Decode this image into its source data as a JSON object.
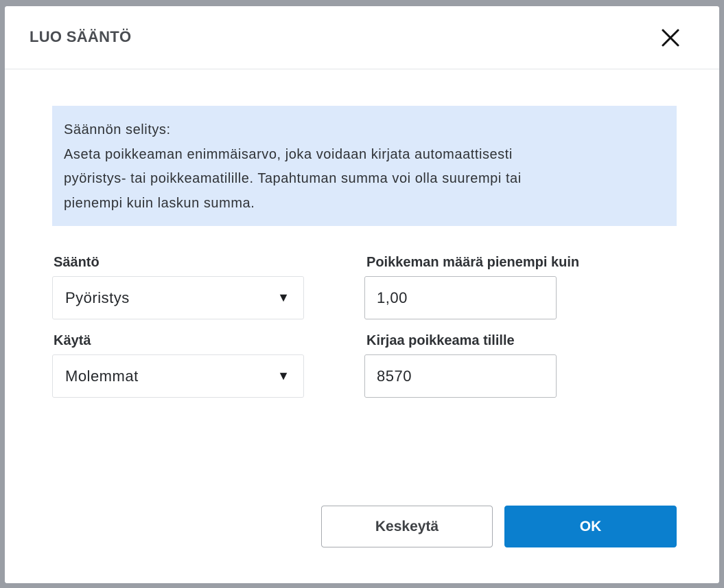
{
  "dialog": {
    "title": "LUO SÄÄNTÖ",
    "close_icon": "close-icon"
  },
  "info": {
    "lines": [
      "Säännön selitys:",
      "Aseta poikkeaman enimmäisarvo, joka voidaan kirjata automaattisesti",
      "pyöristys- tai poikkeamatilille. Tapahtuman summa voi olla suurempi tai",
      "pienempi kuin laskun summa."
    ]
  },
  "form": {
    "rule": {
      "label": "Sääntö",
      "value": "Pyöristys"
    },
    "use": {
      "label": "Käytä",
      "value": "Molemmat"
    },
    "deviation": {
      "label": "Poikkeman määrä pienempi kuin",
      "value": "1,00"
    },
    "account": {
      "label": "Kirjaa poikkeama tilille",
      "value": "8570"
    },
    "dropdown_icon": "▼"
  },
  "buttons": {
    "cancel": "Keskeytä",
    "ok": "OK"
  },
  "colors": {
    "primary": "#0b7fce",
    "info_bg": "#dce9fb"
  }
}
